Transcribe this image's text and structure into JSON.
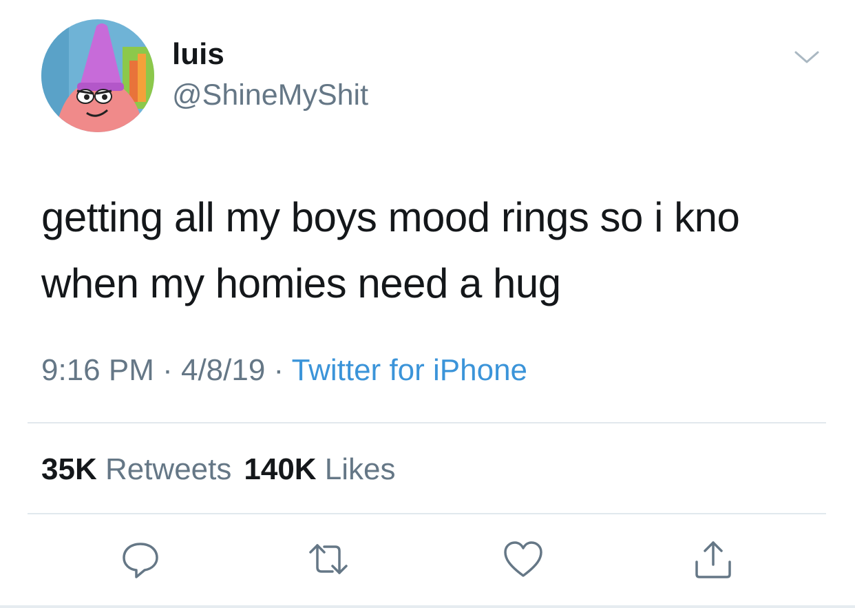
{
  "user": {
    "display_name": "luis",
    "handle": "@ShineMyShit"
  },
  "tweet": {
    "text_line1": "getting all my boys mood rings so i kno",
    "text_line2": "when my homies need a hug"
  },
  "meta": {
    "time": "9:16 PM",
    "separator1": " · ",
    "date": "4/8/19",
    "separator2": " · ",
    "source": "Twitter for iPhone"
  },
  "stats": {
    "retweets_count": "35K",
    "retweets_label": "Retweets",
    "likes_count": "140K",
    "likes_label": "Likes"
  },
  "icons": {
    "reply": "reply-icon",
    "retweet": "retweet-icon",
    "like": "heart-icon",
    "share": "share-icon",
    "more": "chevron-down-icon"
  },
  "colors": {
    "text": "#14171a",
    "secondary": "#657786",
    "link": "#3b94d9",
    "divider": "#e1e8ed"
  }
}
